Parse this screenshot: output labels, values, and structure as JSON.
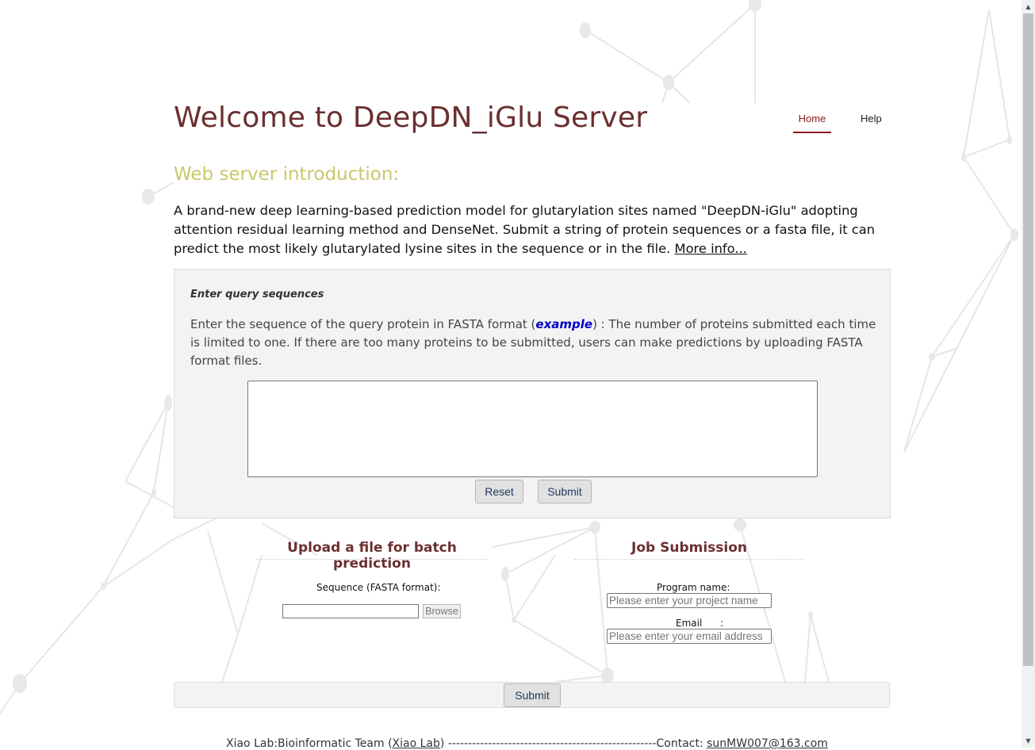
{
  "header": {
    "title": "Welcome to DeepDN_iGlu Server",
    "nav": [
      {
        "label": "Home",
        "active": true
      },
      {
        "label": "Help",
        "active": false
      }
    ]
  },
  "intro": {
    "heading": "Web server introduction:",
    "text": "A brand-new deep learning-based prediction model for glutarylation sites named \"DeepDN-iGlu\" adopting attention residual learning method and DenseNet. Submit a string of protein sequences or a fasta file, it can predict the most likely glutarylated lysine sites in the sequence or in the file.",
    "more_link": "More info..."
  },
  "query": {
    "label": "Enter query sequences",
    "desc_before": "Enter the sequence of the query protein in FASTA format (",
    "example_link": "example",
    "desc_after": ") : The number of proteins submitted each time is limited to one. If there are too many proteins to be submitted, users can make predictions by uploading FASTA format files.",
    "textarea_value": "",
    "reset_label": "Reset",
    "submit_label": "Submit"
  },
  "upload": {
    "title": "Upload a file for batch prediction",
    "sequence_label": "Sequence (FASTA format):",
    "browse_label": "Browse"
  },
  "job": {
    "title": "Job Submission",
    "program_label": "Program name:",
    "program_placeholder": "Please enter your project name",
    "email_label": "Email      :",
    "email_placeholder": "Please enter your email address"
  },
  "submit_bar": {
    "submit_label": "Submit"
  },
  "footer": {
    "text_before": "Xiao Lab:Bioinformatic Team (",
    "lab_link": "Xiao Lab",
    "text_middle": ") ----------------------------------------------------Contact: ",
    "email_link": "sunMW007@163.com"
  },
  "colors": {
    "title": "#6b2f2f",
    "intro_heading": "#c8c86a",
    "nav_active": "#8b1a1a",
    "example_link": "#0000cc",
    "panel_bg": "#f3f3f3"
  },
  "icons": {
    "scroll_up": "scroll-up-arrow-icon",
    "scroll_down": "scroll-down-arrow-icon"
  }
}
